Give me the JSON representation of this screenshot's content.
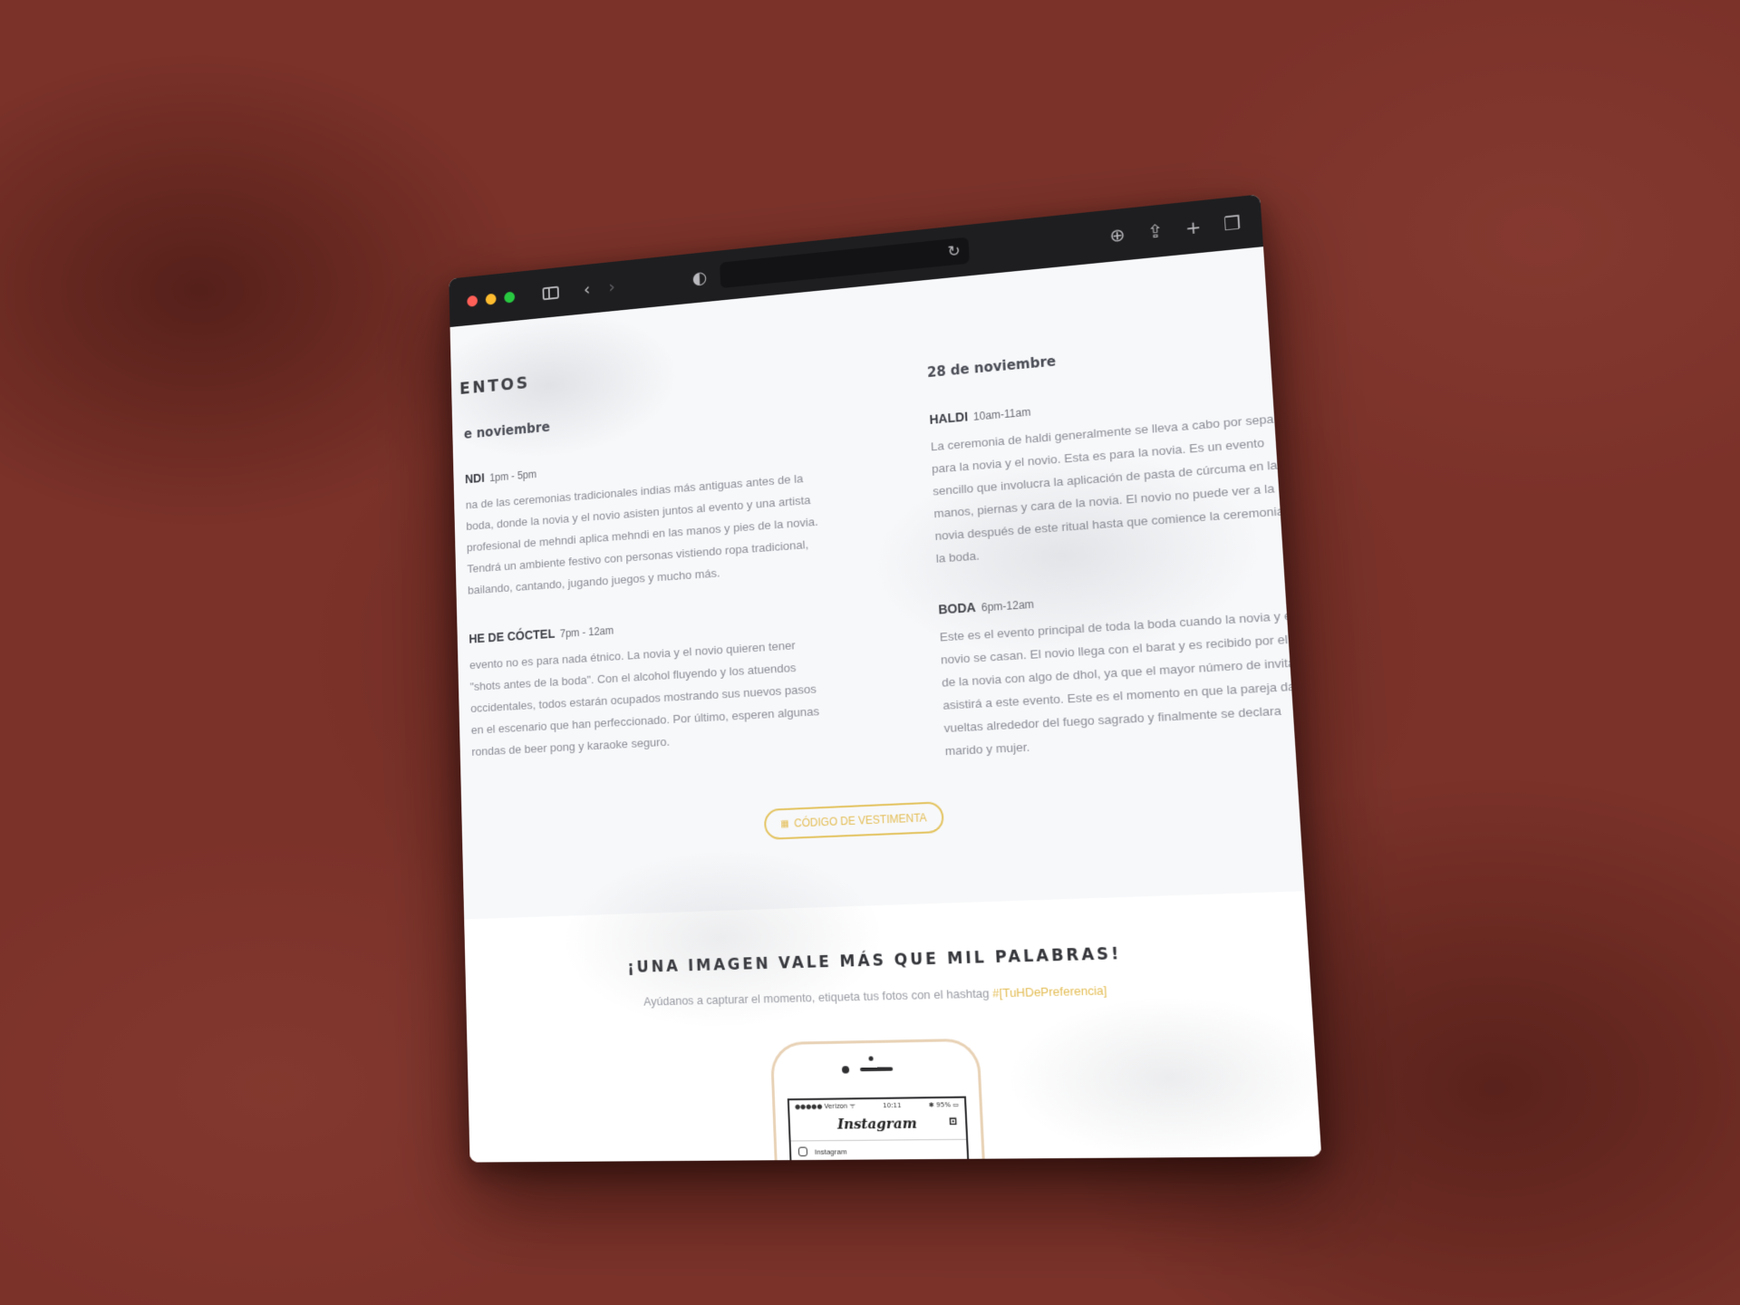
{
  "browser": {
    "address_text": ""
  },
  "events": {
    "section_title": "ENTOS",
    "days": [
      {
        "date": "e noviembre",
        "items": [
          {
            "name": "NDI",
            "time": "1pm - 5pm",
            "description": "na de las ceremonias tradicionales indias más antiguas antes de la boda, donde la novia y el novio asisten juntos al evento y una artista profesional de mehndi aplica mehndi en las manos y pies de la novia. Tendrá un ambiente festivo con personas vistiendo ropa tradicional, bailando, cantando, jugando juegos y mucho más."
          },
          {
            "name": "HE DE CÓCTEL",
            "time": "7pm - 12am",
            "description": "evento no es para nada étnico. La novia y el novio quieren tener \"shots antes de la boda\". Con el alcohol fluyendo y los atuendos occidentales, todos estarán ocupados mostrando sus nuevos pasos en el escenario que han perfeccionado. Por último, esperen algunas rondas de beer pong y karaoke seguro."
          }
        ]
      },
      {
        "date": "28 de noviembre",
        "items": [
          {
            "name": "HALDI",
            "time": "10am-11am",
            "description": "La ceremonia de haldi generalmente se lleva a cabo por separado para la novia y el novio. Esta es para la novia. Es un evento sencillo que involucra la aplicación de pasta de cúrcuma en las manos, piernas y cara de la novia. El novio no puede ver a la novia después de este ritual hasta que comience la ceremonia de la boda."
          },
          {
            "name": "BODA",
            "time": "6pm-12am",
            "description": "Este es el evento principal de toda la boda cuando la novia y el novio se casan. El novio llega con el barat y es recibido por el lado de la novia con algo de dhol, ya que el mayor número de invitados asistirá a este evento. Este es el momento en que la pareja da vueltas alrededor del fuego sagrado y finalmente se declara marido y mujer."
          }
        ]
      }
    ],
    "dress_code_button": "CÓDIGO DE VESTIMENTA"
  },
  "photos": {
    "title": "¡UNA IMAGEN VALE MÁS QUE MIL PALABRAS!",
    "subtitle": "Ayúdanos a capturar el momento, etiqueta tus fotos con el hashtag",
    "hashtag": "#[TuHDePreferencia]",
    "phone": {
      "carrier": "●●●●● Verizon ᯤ",
      "clock": "10:11",
      "battery": "✱ 95% ▭",
      "app_title": "Instagram",
      "row_label": "Instagram"
    }
  },
  "colors": {
    "accent": "#e3bd55",
    "background": "#7b3229"
  }
}
